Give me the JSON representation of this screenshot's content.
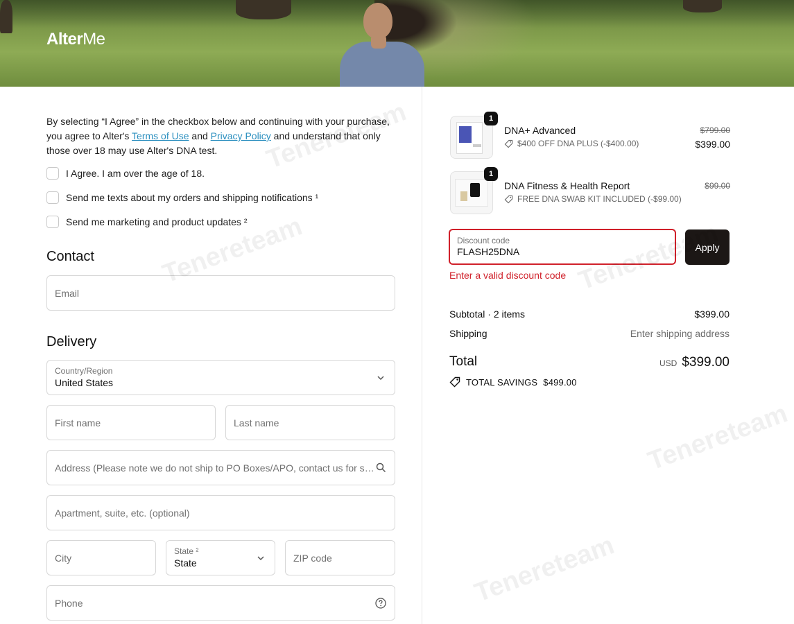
{
  "brand": {
    "logo_bold": "Alter",
    "logo_light": "Me"
  },
  "consent": {
    "text_1": "By selecting “I Agree” in the checkbox below and continuing with your purchase, you agree to Alter's ",
    "terms_link": "Terms of Use",
    "text_and": " and ",
    "privacy_link": "Privacy Policy",
    "text_2": " and understand that only those over 18 may use Alter's DNA test."
  },
  "checkboxes": [
    {
      "label": "I Agree. I am over the age of 18."
    },
    {
      "label": "Send me texts about my orders and shipping notifications ¹"
    },
    {
      "label": "Send me marketing and product updates ²"
    }
  ],
  "contact": {
    "title": "Contact",
    "email_placeholder": "Email"
  },
  "delivery": {
    "title": "Delivery",
    "country_label": "Country/Region",
    "country_value": "United States",
    "first_name_placeholder": "First name",
    "last_name_placeholder": "Last name",
    "address_placeholder": "Address (Please note we do not ship to PO Boxes/APO, contact us for special requests)",
    "apartment_placeholder": "Apartment, suite, etc. (optional)",
    "city_placeholder": "City",
    "state_label": "State ²",
    "state_value": "State",
    "zip_placeholder": "ZIP code",
    "phone_placeholder": "Phone"
  },
  "cart": {
    "items": [
      {
        "name": "DNA+ Advanced",
        "qty": "1",
        "discount": "$400 OFF DNA PLUS (-$400.00)",
        "price_old": "$799.00",
        "price_new": "$399.00"
      },
      {
        "name": "DNA Fitness & Health Report",
        "qty": "1",
        "discount": "FREE DNA SWAB KIT INCLUDED (-$99.00)",
        "price_old": "$99.00",
        "price_new": ""
      }
    ],
    "discount_label": "Discount code",
    "discount_value": "FLASH25DNA",
    "apply_label": "Apply",
    "error": "Enter a valid discount code",
    "subtotal_label": "Subtotal · 2 items",
    "subtotal_value": "$399.00",
    "shipping_label": "Shipping",
    "shipping_value": "Enter shipping address",
    "total_label": "Total",
    "currency": "USD",
    "total_value": "$399.00",
    "savings_label": "TOTAL SAVINGS",
    "savings_value": "$499.00"
  },
  "watermark": "Tenereteam",
  "colors": {
    "error": "#d0202a",
    "link": "#2b8fbf",
    "button": "#1c1715"
  },
  "icons": [
    "chevron-down-icon",
    "search-icon",
    "help-icon",
    "tag-icon"
  ]
}
